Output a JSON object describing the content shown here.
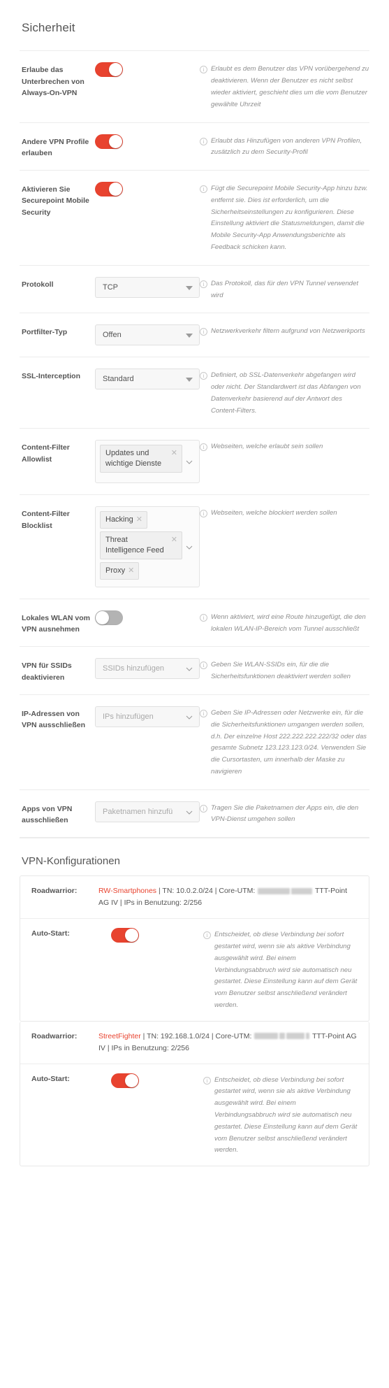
{
  "page": {
    "title": "Sicherheit",
    "vpn_section_title": "VPN-Konfigurationen"
  },
  "colors": {
    "toggle_on": "#e8432f",
    "toggle_off": "#b3b3b3",
    "link": "#e8432f",
    "help_text": "#8e8e8e",
    "label": "#555555"
  },
  "settings": [
    {
      "id": "allow-interrupt-always-on-vpn",
      "label": "Erlaube das Unterbrechen von Always-On-VPN",
      "control": "toggle",
      "value": "on",
      "help": "Erlaubt es dem Benutzer das VPN vorübergehend zu deaktivieren. Wenn der Benutzer es nicht selbst wieder aktiviert, geschieht dies um die vom Benutzer gewählte Uhrzeit"
    },
    {
      "id": "allow-other-vpn-profiles",
      "label": "Andere VPN Profile erlauben",
      "control": "toggle",
      "value": "on",
      "help": "Erlaubt das Hinzufügen von anderen VPN Profilen, zusätzlich zu dem Security-Profil"
    },
    {
      "id": "enable-securepoint-mobile-security",
      "label": "Aktivieren Sie Securepoint Mobile Security",
      "control": "toggle",
      "value": "on",
      "help": "Fügt die Securepoint Mobile Security-App hinzu bzw. entfernt sie. Dies ist erforderlich, um die Sicherheitseinstellungen zu konfigurieren. Diese Einstellung aktiviert die Statusmeldungen, damit die Mobile Security-App Anwendungsberichte als Feedback schicken kann."
    },
    {
      "id": "protocol",
      "label": "Protokoll",
      "control": "select",
      "value": "TCP",
      "help": "Das Protokoll, das für den VPN Tunnel verwendet wird"
    },
    {
      "id": "port-filter-type",
      "label": "Portfilter-Typ",
      "control": "select",
      "value": "Offen",
      "help": "Netzwerkverkehr filtern aufgrund von Netzwerkports"
    },
    {
      "id": "ssl-interception",
      "label": "SSL-Interception",
      "control": "select",
      "value": "Standard",
      "help": "Definiert, ob SSL-Datenverkehr abgefangen wird oder nicht. Der Standardwert ist das Abfangen von Datenverkehr basierend auf der Antwort des Content-Filters."
    },
    {
      "id": "content-filter-allowlist",
      "label": "Content-Filter Allowlist",
      "control": "chips",
      "chips": [
        "Updates und wichtige Dienste"
      ],
      "help": "Webseiten, welche erlaubt sein sollen"
    },
    {
      "id": "content-filter-blocklist",
      "label": "Content-Filter Blocklist",
      "control": "chips",
      "chips": [
        "Hacking",
        "Threat Intelligence Feed",
        "Proxy"
      ],
      "help": "Webseiten, welche blockiert werden sollen"
    },
    {
      "id": "exclude-local-wlan-from-vpn",
      "label": "Lokales WLAN vom VPN ausnehmen",
      "control": "toggle",
      "value": "off",
      "help": "Wenn aktiviert, wird eine Route hinzugefügt, die den lokalen WLAN-IP-Bereich vom Tunnel ausschließt"
    },
    {
      "id": "disable-vpn-for-ssids",
      "label": "VPN für SSIDs deaktivieren",
      "control": "select-placeholder",
      "placeholder": "SSIDs hinzufügen",
      "help": "Geben Sie WLAN-SSIDs ein, für die die Sicherheitsfunktionen deaktiviert werden sollen"
    },
    {
      "id": "exclude-ip-addresses-from-vpn",
      "label": "IP-Adressen von VPN ausschließen",
      "control": "select-placeholder",
      "placeholder": "IPs hinzufügen",
      "help": "Geben Sie IP-Adressen oder Netzwerke ein, für die die Sicherheitsfunktionen umgangen werden sollen, d.h. Der einzelne Host 222.222.222.222/32 oder das gesamte Subnetz 123.123.123.0/24. Verwenden Sie die Cursortasten, um innerhalb der Maske zu navigieren"
    },
    {
      "id": "exclude-apps-from-vpn",
      "label": "Apps von VPN ausschließen",
      "control": "select-placeholder",
      "placeholder": "Paketnamen hinzufü",
      "help": "Tragen Sie die Paketnamen der Apps ein, die den VPN-Dienst umgehen sollen"
    }
  ],
  "vpn_configs": [
    {
      "roadwarrior_label": "Roadwarrior:",
      "name": "RW-Smartphones",
      "detail_1": " | TN: 10.0.2.0/24 | Core-UTM: ",
      "detail_2": " TTT-Point AG IV | IPs in Benutzung: 2/256",
      "autostart_label": "Auto-Start:",
      "autostart_value": "on",
      "autostart_help": "Entscheidet, ob diese Verbindung bei sofort gestartet wird, wenn sie als aktive Verbindung ausgewählt wird. Bei einem Verbindungsabbruch wird sie automatisch neu gestartet. Diese Einstellung kann auf dem Gerät vom Benutzer selbst anschließend verändert werden."
    },
    {
      "roadwarrior_label": "Roadwarrior:",
      "name": "StreetFighter",
      "detail_1": " | TN: 192.168.1.0/24 | Core-UTM: ",
      "detail_2": " TTT-Point AG IV | IPs in Benutzung: 2/256",
      "autostart_label": "Auto-Start:",
      "autostart_value": "on",
      "autostart_help": "Entscheidet, ob diese Verbindung bei sofort gestartet wird, wenn sie als aktive Verbindung ausgewählt wird. Bei einem Verbindungsabbruch wird sie automatisch neu gestartet. Diese Einstellung kann auf dem Gerät vom Benutzer selbst anschließend verändert werden."
    }
  ]
}
